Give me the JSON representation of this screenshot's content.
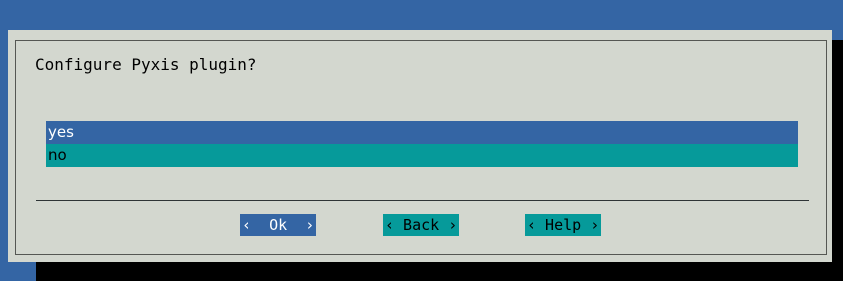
{
  "dialog": {
    "prompt": "Configure Pyxis plugin?",
    "options": [
      {
        "label": "yes",
        "selected": true
      },
      {
        "label": "no",
        "selected": false
      }
    ]
  },
  "buttons": {
    "ok_label": "‹  Ok  ›",
    "back_label": "‹ Back ›",
    "help_label": "‹ Help ›"
  },
  "colors": {
    "background": "#3465a4",
    "dialog": "#d3d7cf",
    "selected": "#3465a4",
    "unselected": "#069a9a"
  }
}
